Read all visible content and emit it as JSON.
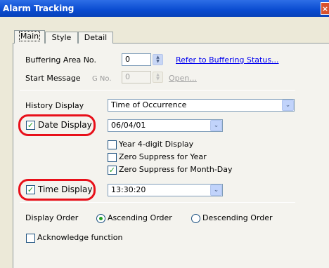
{
  "window": {
    "title": "Alarm Tracking",
    "close_glyph": "×"
  },
  "tabs": [
    {
      "label": "Main",
      "active": true
    },
    {
      "label": "Style",
      "active": false
    },
    {
      "label": "Detail",
      "active": false
    }
  ],
  "buffering": {
    "label": "Buffering Area No.",
    "value": "0",
    "link": "Refer to Buffering Status..."
  },
  "start_message": {
    "label": "Start Message",
    "gno_label": "G No.",
    "value": "0",
    "open_label": "Open..."
  },
  "history_display": {
    "label": "History Display",
    "value": "Time of Occurrence"
  },
  "date_display": {
    "label": "Date Display",
    "checked": true,
    "value": "06/04/01",
    "options": [
      {
        "label": "Year 4-digit Display",
        "checked": false
      },
      {
        "label": "Zero Suppress for Year",
        "checked": false
      },
      {
        "label": "Zero Suppress for Month-Day",
        "checked": true
      }
    ]
  },
  "time_display": {
    "label": "Time Display",
    "checked": true,
    "value": "13:30:20"
  },
  "display_order": {
    "label": "Display Order",
    "options": [
      {
        "label": "Ascending Order",
        "selected": true
      },
      {
        "label": "Descending Order",
        "selected": false
      }
    ]
  },
  "acknowledge": {
    "label": "Acknowledge function",
    "checked": false
  },
  "glyphs": {
    "check": "✓",
    "spin_up": "▲",
    "spin_down": "▼",
    "dropdown": "⌄"
  },
  "colors": {
    "titlebar": "#0a4bd0",
    "highlight_oval": "#e8101a",
    "check": "#21a121",
    "link": "#0000ee"
  }
}
